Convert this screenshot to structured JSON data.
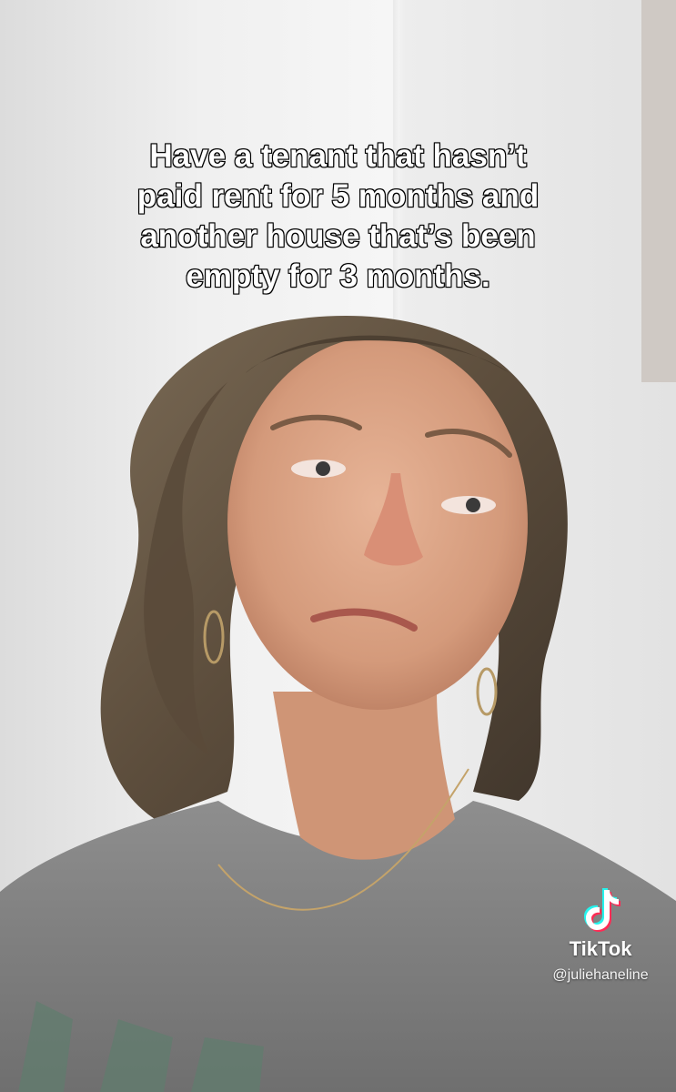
{
  "caption": {
    "lines": [
      "Have a tenant that hasn’t",
      "paid rent for 5 months and",
      "another house that’s been",
      "empty for 3 months."
    ]
  },
  "watermark": {
    "icon": "tiktok-logo-icon",
    "brand": "TikTok",
    "handle": "@juliehaneline"
  },
  "colors": {
    "caption_text": "#ffffff",
    "caption_stroke": "#000000",
    "tiktok_cyan": "#25f4ee",
    "tiktok_red": "#fe2c55",
    "wall": "#f0f0f0",
    "shirt": "#8a8a8a",
    "hair": "#6b5a45",
    "skin": "#d9a184"
  }
}
